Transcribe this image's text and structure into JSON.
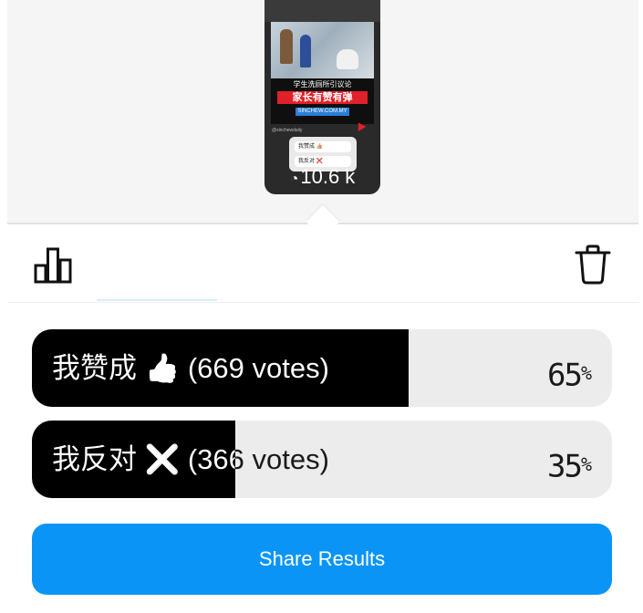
{
  "story_preview": {
    "caption_line1": "学生洗厕所引议论",
    "caption_line2": "家长有赞有弹",
    "caption_source": "SINCHEW.COM.MY",
    "handle": "@sinchewdaily",
    "poll_options": [
      "我赞成 👍🏼",
      "我反对 ❌"
    ],
    "views": "10.6 k"
  },
  "toolbar": {
    "chart_icon": "bar-chart-icon",
    "delete_icon": "trash-icon"
  },
  "poll": {
    "options": [
      {
        "label": "我赞成 👍🏼 (669 votes)",
        "votes": 669,
        "percent_number": "65",
        "percent_sign": "%",
        "fill_fraction": 0.65
      },
      {
        "label": "我反对 ❌ (366 votes)",
        "votes": 366,
        "percent_number": "35",
        "percent_sign": "%",
        "fill_fraction": 0.35
      }
    ]
  },
  "actions": {
    "share_label": "Share Results"
  },
  "colors": {
    "accent": "#0a95f6",
    "bar_fill": "#000000",
    "bar_track": "#ececec"
  }
}
